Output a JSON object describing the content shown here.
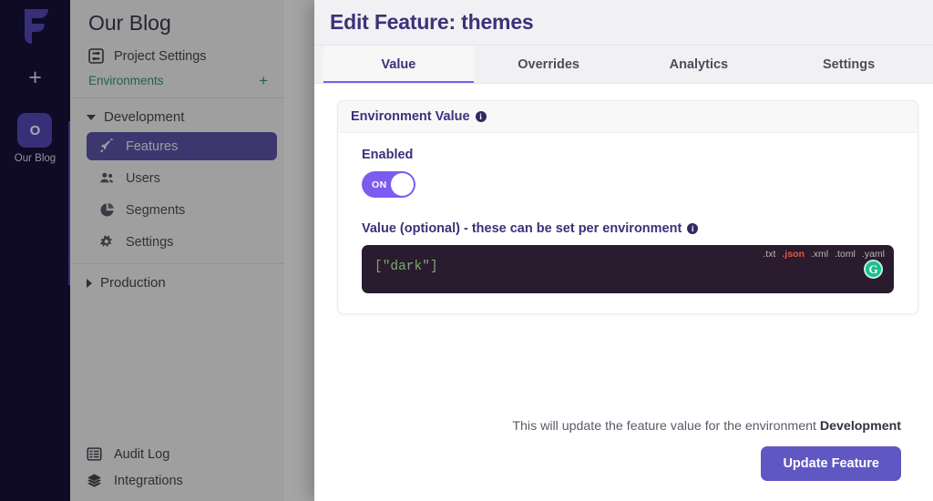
{
  "colors": {
    "brand_purple": "#4b42a3",
    "toggle_purple": "#7b5cf0",
    "button_purple": "#5f57c2",
    "title_navy": "#3b3279",
    "rail_dark": "#120c2c",
    "env_green": "#1d8a6f",
    "editor_bg": "#2a1b2e",
    "code_green": "#7cab6e",
    "format_active": "#e8563f",
    "cursor_green": "#1bbf8a"
  },
  "rail": {
    "logo_icon": "flagsmith-logo-icon",
    "add_icon": "plus-icon",
    "org_initial": "O",
    "org_label": "Our Blog"
  },
  "sidebar": {
    "project_title": "Our Blog",
    "project_settings": {
      "label": "Project Settings",
      "icon": "sliders-icon"
    },
    "environments_header": {
      "label": "Environments",
      "add_icon": "plus-icon"
    },
    "environments": [
      {
        "name": "Development",
        "expanded": true,
        "items": [
          {
            "label": "Features",
            "icon": "rocket-icon",
            "active": true
          },
          {
            "label": "Users",
            "icon": "users-icon",
            "active": false
          },
          {
            "label": "Segments",
            "icon": "pie-chart-icon",
            "active": false
          },
          {
            "label": "Settings",
            "icon": "gears-icon",
            "active": false
          }
        ]
      },
      {
        "name": "Production",
        "expanded": false,
        "items": []
      }
    ],
    "bottom_items": [
      {
        "label": "Audit Log",
        "icon": "table-icon"
      },
      {
        "label": "Integrations",
        "icon": "layers-icon"
      }
    ]
  },
  "modal": {
    "title": "Edit Feature: themes",
    "tabs": [
      {
        "label": "Value",
        "active": true
      },
      {
        "label": "Overrides",
        "active": false
      },
      {
        "label": "Analytics",
        "active": false
      },
      {
        "label": "Settings",
        "active": false
      }
    ],
    "card": {
      "header_title": "Environment Value",
      "header_info_icon": "info-icon",
      "enabled_label": "Enabled",
      "toggle_state": "ON",
      "value_label": "Value (optional) - these can be set per environment",
      "value_info_icon": "info-icon",
      "editor_value": "[\"dark\"]",
      "formats": [
        {
          "label": ".txt",
          "active": false
        },
        {
          "label": ".json",
          "active": true
        },
        {
          "label": ".xml",
          "active": false
        },
        {
          "label": ".toml",
          "active": false
        },
        {
          "label": ".yaml",
          "active": false
        }
      ],
      "cursor_marker": "G"
    },
    "footer": {
      "note_prefix": "This will update the feature value for the environment ",
      "note_environment": "Development",
      "update_button": "Update Feature"
    }
  }
}
